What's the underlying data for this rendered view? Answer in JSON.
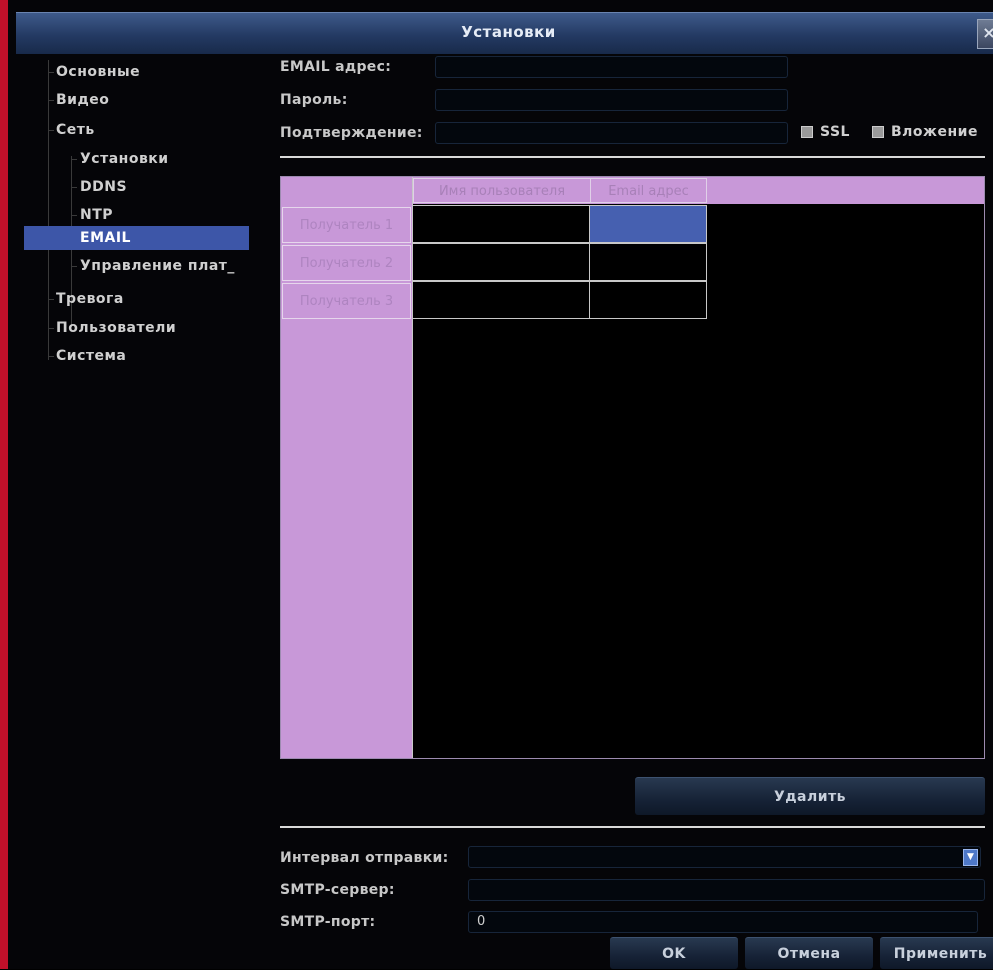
{
  "window": {
    "title": "Установки",
    "close_glyph": "×"
  },
  "sidebar": {
    "items": [
      {
        "label": "Основные"
      },
      {
        "label": "Видео"
      },
      {
        "label": "Сеть"
      },
      {
        "label": "Установки"
      },
      {
        "label": "DDNS"
      },
      {
        "label": "NTP"
      },
      {
        "label": "EMAIL",
        "selected": true
      },
      {
        "label": "Управление плат_"
      },
      {
        "label": "Тревога"
      },
      {
        "label": "Пользователи"
      },
      {
        "label": "Система"
      }
    ]
  },
  "form": {
    "email_label": "EMAIL адрес:",
    "email_value": "",
    "password_label": "Пароль:",
    "password_value": "",
    "confirm_label": "Подтверждение:",
    "confirm_value": "",
    "ssl_label": "SSL",
    "attachment_label": "Вложение"
  },
  "recipients": {
    "columns": [
      "Имя пользователя",
      "Email адрес"
    ],
    "rows": [
      {
        "label": "Получатель 1",
        "name": "",
        "email": ""
      },
      {
        "label": "Получатель 2",
        "name": "",
        "email": ""
      },
      {
        "label": "Получатель 3",
        "name": "",
        "email": ""
      }
    ]
  },
  "delete_label": "Удалить",
  "smtp": {
    "interval_label": "Интервал отправки:",
    "interval_value": "",
    "server_label": "SMTP-сервер:",
    "server_value": "",
    "port_label": "SMTP-порт:",
    "port_value": "0"
  },
  "footer": {
    "ok_label": "OK",
    "cancel_label": "Отмена",
    "apply_label": "Применить"
  },
  "colors": {
    "accent": "#3d56a8",
    "grid_header": "#c898d8",
    "title_bar": "#243a63",
    "frame_border": "#c0102a"
  }
}
